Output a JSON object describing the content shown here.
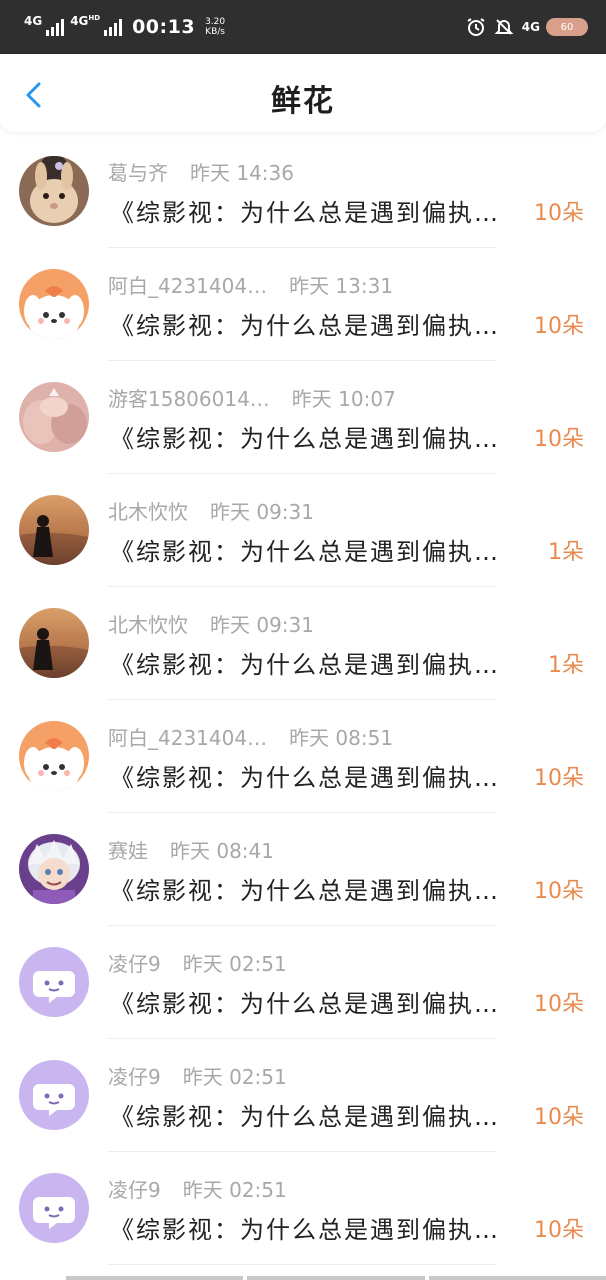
{
  "status_bar": {
    "network_1": "4G",
    "network_2": "4G",
    "network_2_suffix": "HD",
    "time": "00:13",
    "speed_value": "3.20",
    "speed_unit": "KB/s",
    "network_3": "4G",
    "battery": "60"
  },
  "header": {
    "title": "鲜花"
  },
  "colors": {
    "accent": "#2a97ee",
    "count": "#e98a4e",
    "meta": "#a8a8a8"
  },
  "items": [
    {
      "name": "葛与齐",
      "time": "昨天 14:36",
      "message": "《综影视：为什么总是遇到偏执…",
      "count": "10朵",
      "avatar": "rabbit"
    },
    {
      "name": "阿白_4231404…",
      "time": "昨天 13:31",
      "message": "《综影视：为什么总是遇到偏执…",
      "count": "10朵",
      "avatar": "puppy"
    },
    {
      "name": "游客15806014…",
      "time": "昨天 10:07",
      "message": "《综影视：为什么总是遇到偏执…",
      "count": "10朵",
      "avatar": "pink-photo"
    },
    {
      "name": "北木忺忺",
      "time": "昨天 09:31",
      "message": "《综影视：为什么总是遇到偏执…",
      "count": "1朵",
      "avatar": "sunset"
    },
    {
      "name": "北木忺忺",
      "time": "昨天 09:31",
      "message": "《综影视：为什么总是遇到偏执…",
      "count": "1朵",
      "avatar": "sunset"
    },
    {
      "name": "阿白_4231404…",
      "time": "昨天 08:51",
      "message": "《综影视：为什么总是遇到偏执…",
      "count": "10朵",
      "avatar": "puppy"
    },
    {
      "name": "赛娃",
      "time": "昨天 08:41",
      "message": "《综影视：为什么总是遇到偏执…",
      "count": "10朵",
      "avatar": "anime"
    },
    {
      "name": "凌仔9",
      "time": "昨天 02:51",
      "message": "《综影视：为什么总是遇到偏执…",
      "count": "10朵",
      "avatar": "chat-bubble"
    },
    {
      "name": "凌仔9",
      "time": "昨天 02:51",
      "message": "《综影视：为什么总是遇到偏执…",
      "count": "10朵",
      "avatar": "chat-bubble"
    },
    {
      "name": "凌仔9",
      "time": "昨天 02:51",
      "message": "《综影视：为什么总是遇到偏执…",
      "count": "10朵",
      "avatar": "chat-bubble"
    }
  ]
}
